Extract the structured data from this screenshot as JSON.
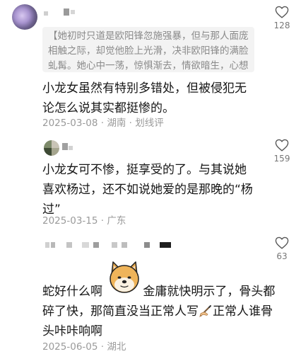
{
  "comments": [
    {
      "quote": "【她初时只道是欧阳锋忽施强暴，但与那人面庞相触之际，却觉他脸上光滑，决非欧阳锋的满脸虬髯。她心中一荡，惊惧渐去，情欲暗生，心想",
      "text": "小龙女虽然有特别多错处，但被侵犯无论怎么说其实都挺惨的。",
      "date": "2025-03-08",
      "location": "湖南",
      "action": "划线评",
      "likes": "128"
    },
    {
      "text": "小龙女可不惨，挺享受的了。与其说她喜欢杨过，还不如说她爱的是那晚的“杨过”",
      "date": "2025-03-15",
      "location": "广东",
      "likes": "159"
    },
    {
      "text_before_emoji": "蛇好什么啊",
      "text_after_emoji": " 金庸就快明示了，骨头都碎了快，那简直没当正常人写",
      "text_after_icon": "正常人谁骨头咔咔响啊",
      "date": "2025-06-05",
      "location": "湖北",
      "likes": "63"
    }
  ],
  "separator": " · ",
  "icons": {
    "like": "heart-outline-icon",
    "emoji": "doge-emoji",
    "writing": "writing-hand-emoji"
  },
  "colors": {
    "text": "#161616",
    "meta": "#9a9a9a",
    "quote_bg": "#f3f3f3",
    "quote_text": "#8a8a8a"
  }
}
